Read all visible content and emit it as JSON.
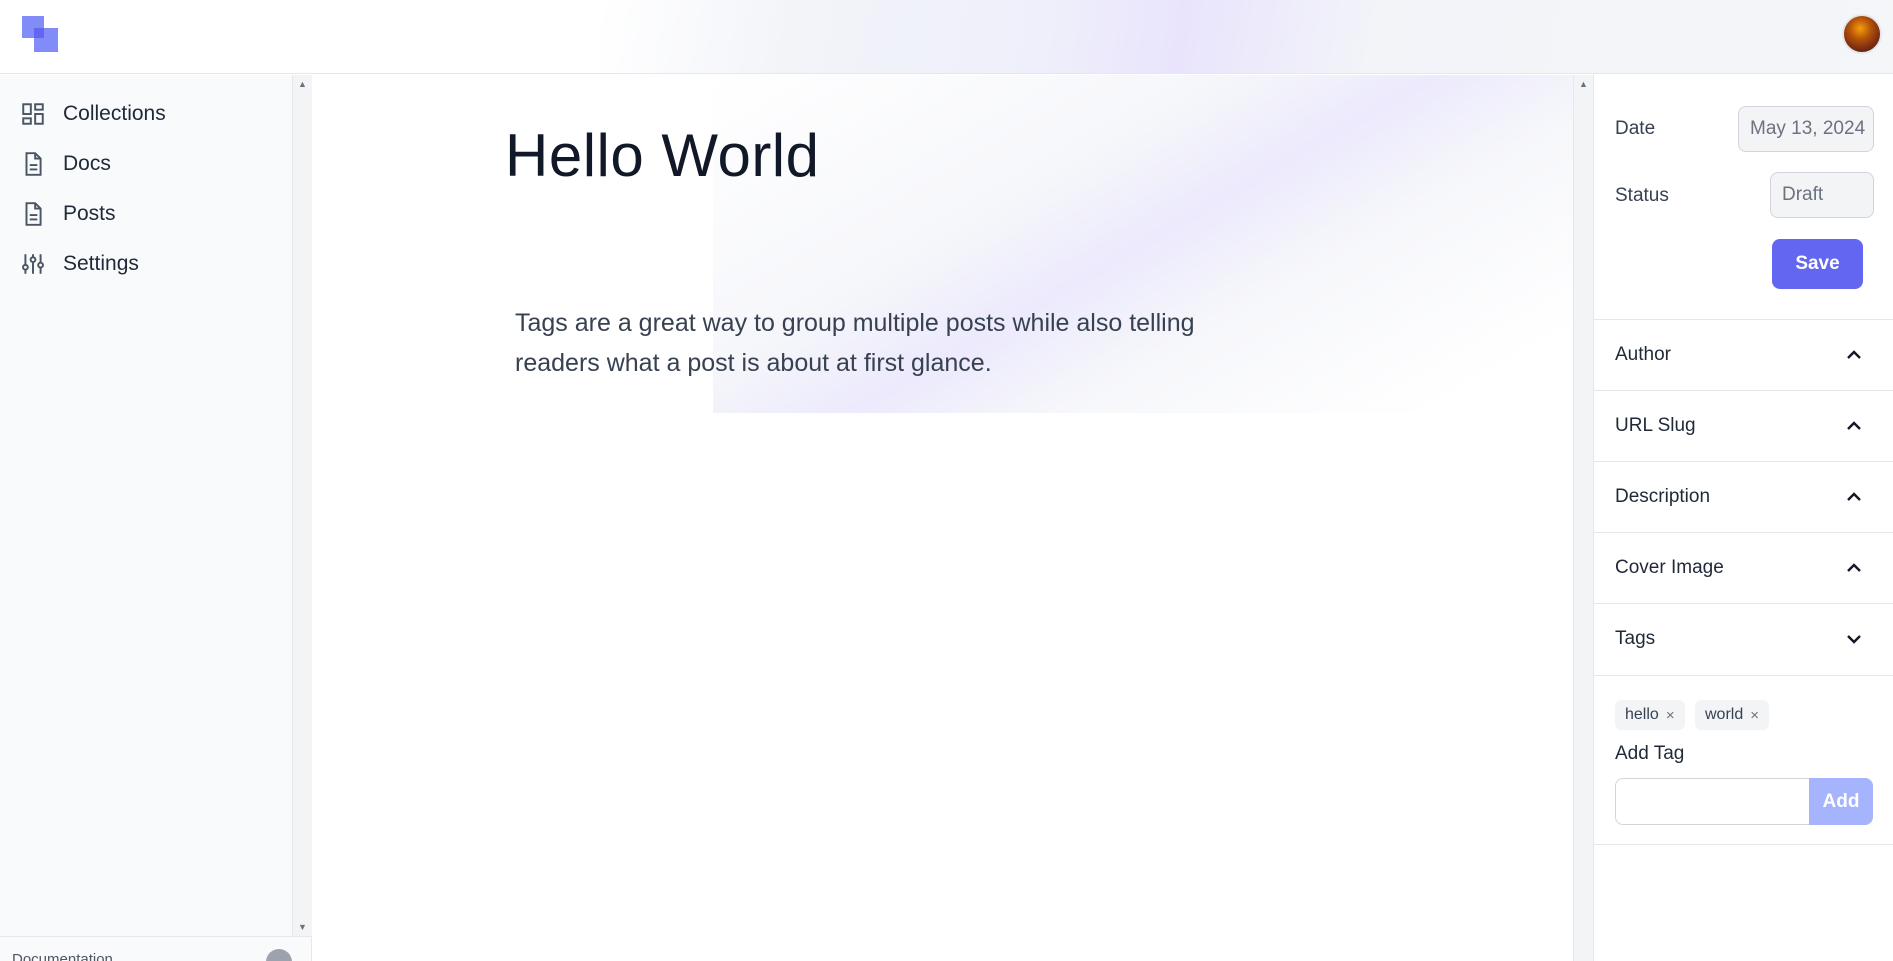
{
  "header": {
    "logo_icon": "logo-squares-icon",
    "avatar_icon": "user-avatar",
    "accent_color": "#6366f1"
  },
  "sidebar": {
    "items": [
      {
        "label": "Collections",
        "icon": "grid-dashboard-icon"
      },
      {
        "label": "Docs",
        "icon": "document-icon"
      },
      {
        "label": "Posts",
        "icon": "document-icon"
      },
      {
        "label": "Settings",
        "icon": "sliders-icon"
      }
    ],
    "footer_label": "Documentation",
    "footer_icon": "github-icon"
  },
  "main": {
    "title": "Hello World",
    "body": "Tags are a great way to group multiple posts while also telling readers what a post is about at first glance."
  },
  "panel": {
    "date_label": "Date",
    "date_value": "May 13, 2024",
    "status_label": "Status",
    "status_value": "Draft",
    "save_label": "Save",
    "sections": [
      {
        "label": "Author",
        "state": "chevron-up-icon"
      },
      {
        "label": "URL Slug",
        "state": "chevron-up-icon"
      },
      {
        "label": "Description",
        "state": "chevron-up-icon"
      },
      {
        "label": "Cover Image",
        "state": "chevron-up-icon"
      },
      {
        "label": "Tags",
        "state": "chevron-down-icon"
      }
    ],
    "tags": [
      "hello",
      "world"
    ],
    "tag_remove_glyph": "×",
    "add_tag_label": "Add Tag",
    "add_tag_value": "",
    "add_button_label": "Add",
    "save_color": "#6366f1",
    "add_button_color": "#a5b4fc"
  }
}
